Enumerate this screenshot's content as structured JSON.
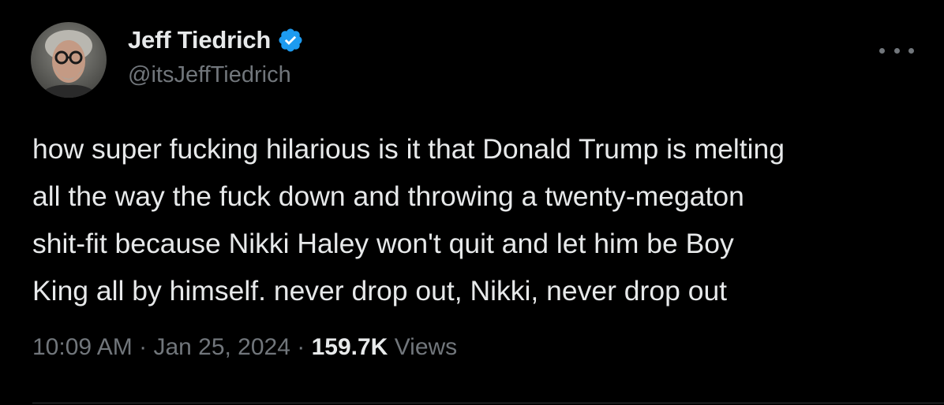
{
  "tweet": {
    "author": {
      "display_name": "Jeff Tiedrich",
      "handle": "@itsJeffTiedrich",
      "verified": true,
      "avatar": "profile-photo"
    },
    "more_icon": "ellipsis-icon",
    "text": "how super fucking hilarious is it that Donald Trump is melting\nall the way the fuck down and throwing a twenty-megaton\nshit-fit because Nikki Haley won't quit and let him be Boy\nKing all by himself. never drop out, Nikki, never drop out",
    "meta": {
      "time": "10:09 AM",
      "separator": " · ",
      "date": "Jan 25, 2024",
      "views_count": "159.7K",
      "views_label": "Views"
    }
  },
  "colors": {
    "background": "#000000",
    "primary_text": "#e7e9ea",
    "secondary_text": "#71767b",
    "verified_blue": "#1d9bf0"
  }
}
